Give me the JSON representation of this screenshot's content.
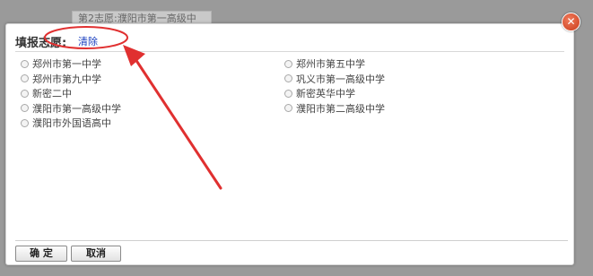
{
  "background_window": {
    "text": "第2志愿:濮阳市第一高级中"
  },
  "dialog": {
    "title": "填报志愿:",
    "clear_link": "清除",
    "options_left": [
      "郑州市第一中学",
      "郑州市第九中学",
      "新密二中",
      "濮阳市第一高级中学",
      "濮阳市外国语高中"
    ],
    "options_right": [
      "郑州市第五中学",
      "巩义市第一高级中学",
      "新密英华中学",
      "濮阳市第二高级中学"
    ],
    "ok_button": "确 定",
    "cancel_button": "取消"
  },
  "close_icon_glyph": "✕",
  "colors": {
    "annotation": "#e03030",
    "link": "#1a3fbf"
  }
}
